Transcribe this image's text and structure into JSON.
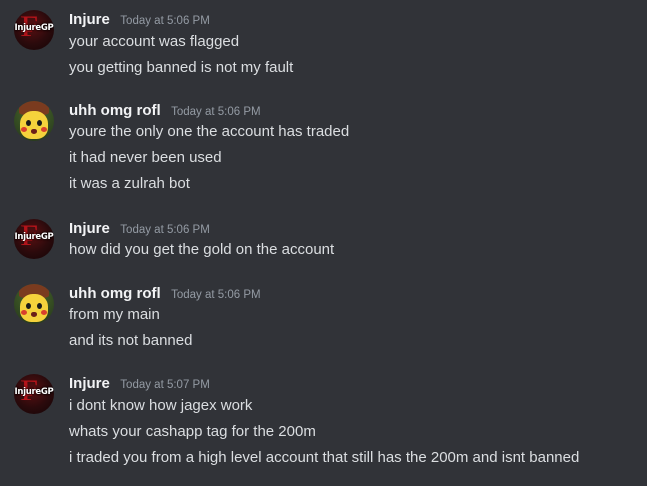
{
  "messages": [
    {
      "author": "Injure",
      "avatar_text": "InjureGP",
      "timestamp": "Today at 5:06 PM",
      "lines": [
        "your account was flagged",
        "you getting banned is not my fault"
      ]
    },
    {
      "author": "uhh omg rofl",
      "timestamp": "Today at 5:06 PM",
      "lines": [
        "youre the only one the account has traded",
        "it had never been used",
        "it was a zulrah bot"
      ]
    },
    {
      "author": "Injure",
      "avatar_text": "InjureGP",
      "timestamp": "Today at 5:06 PM",
      "lines": [
        "how did you get the gold on the account"
      ]
    },
    {
      "author": "uhh omg rofl",
      "timestamp": "Today at 5:06 PM",
      "lines": [
        "from my main",
        "and its not banned"
      ]
    },
    {
      "author": "Injure",
      "avatar_text": "InjureGP",
      "timestamp": "Today at 5:07 PM",
      "lines": [
        "i dont know how jagex work",
        "whats your cashapp tag for the 200m",
        "i traded you from a high level account that still has the 200m and isnt banned"
      ]
    }
  ],
  "colors": {
    "background": "#313338",
    "username": "#f2f3f5",
    "timestamp": "#949ba4",
    "message_text": "#dbdee1"
  },
  "icons": {
    "injure_avatar": "injuregp-avatar-icon",
    "pikachu_avatar": "pikachu-avatar-icon"
  }
}
